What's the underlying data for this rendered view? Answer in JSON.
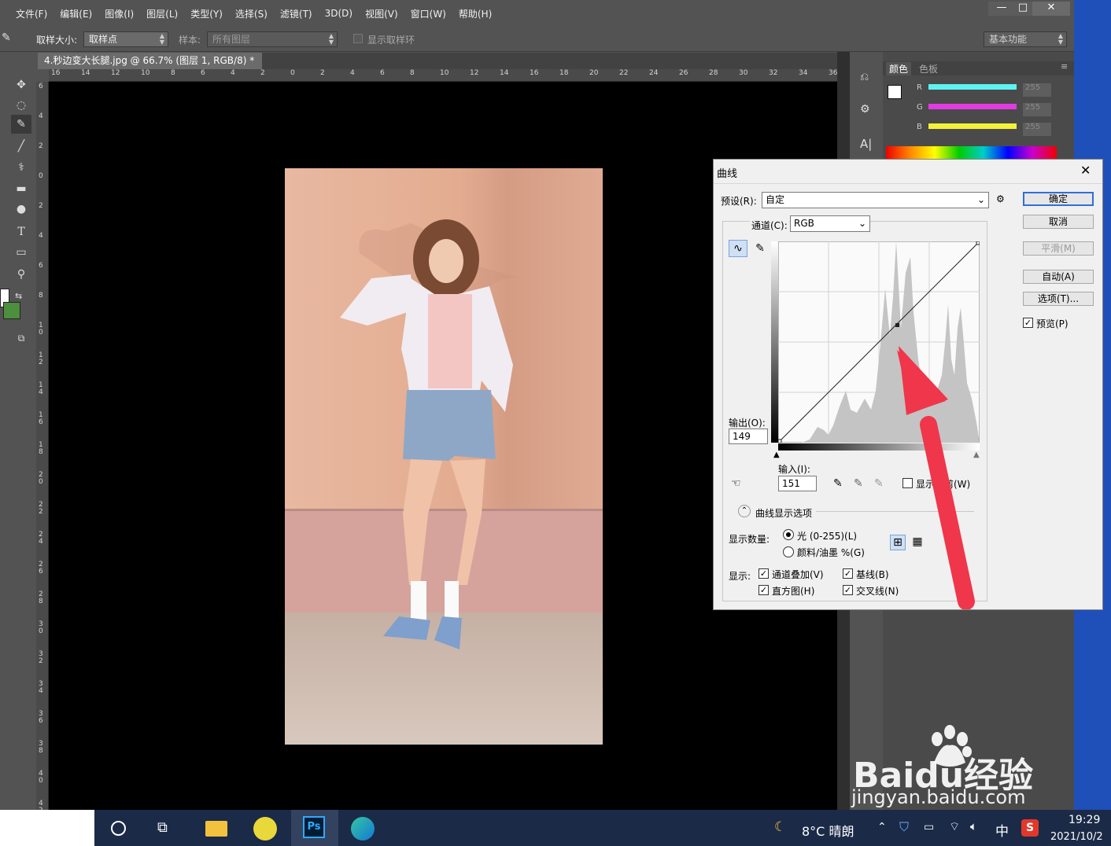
{
  "menu": [
    "文件(F)",
    "编辑(E)",
    "图像(I)",
    "图层(L)",
    "类型(Y)",
    "选择(S)",
    "滤镜(T)",
    "3D(D)",
    "视图(V)",
    "窗口(W)",
    "帮助(H)"
  ],
  "window_buttons": [
    "—",
    "□",
    "✕"
  ],
  "options": {
    "sample_size_label": "取样大小:",
    "sample_size_value": "取样点",
    "sample_label": "样本:",
    "sample_value": "所有图层",
    "show_ring_label": "显示取样环",
    "workspace": "基本功能"
  },
  "doc_tab": {
    "title": "4.秒边变大长腿.jpg @ 66.7% (图层 1, RGB/8) *",
    "close": "×"
  },
  "hruler": [
    "16",
    "14",
    "12",
    "10",
    "8",
    "6",
    "4",
    "2",
    "0",
    "2",
    "4",
    "6",
    "8",
    "10",
    "12",
    "14",
    "16",
    "18",
    "20",
    "22",
    "24",
    "26",
    "28",
    "30",
    "32",
    "34",
    "36"
  ],
  "vruler": [
    "6",
    "4",
    "2",
    "0",
    "2",
    "4",
    "6",
    "8",
    "10",
    "12",
    "14",
    "16",
    "18",
    "20",
    "22",
    "24",
    "26",
    "28",
    "30",
    "32",
    "34",
    "36",
    "38",
    "40",
    "42"
  ],
  "color_panel": {
    "tab1": "颜色",
    "tab2": "色板",
    "channels": [
      {
        "label": "R",
        "value": "255",
        "color": "#5ef2f2"
      },
      {
        "label": "G",
        "value": "255",
        "color": "#e23be2"
      },
      {
        "label": "B",
        "value": "255",
        "color": "#f2f23a"
      }
    ],
    "fg": "#ffffff",
    "bg": "#4c8f3c"
  },
  "curves": {
    "title": "曲线",
    "close": "✕",
    "preset_label": "预设(R):",
    "preset_value": "自定",
    "channel_label": "通道(C):",
    "channel_value": "RGB",
    "output_label": "输出(O):",
    "output_value": "149",
    "input_label": "输入(I):",
    "input_value": "151",
    "show_clip_label": "显示修剪(W)",
    "display_options_label": "曲线显示选项",
    "amount_label": "显示数量:",
    "light_label": "光 (0-255)(L)",
    "pigment_label": "颜料/油墨 %(G)",
    "show_label": "显示:",
    "overlay_label": "通道叠加(V)",
    "baseline_label": "基线(B)",
    "histogram_label": "直方图(H)",
    "crosshair_label": "交叉线(N)",
    "buttons": {
      "ok": "确定",
      "cancel": "取消",
      "smooth": "平滑(M)",
      "auto": "自动(A)",
      "options": "选项(T)...",
      "preview": "预览(P)"
    }
  },
  "watermark": {
    "brand": "Baidu经验",
    "url": "jingyan.baidu.com"
  },
  "taskbar": {
    "weather": "8°C 晴朗",
    "ime": "中",
    "time": "19:29",
    "date": "2021/10/2"
  }
}
